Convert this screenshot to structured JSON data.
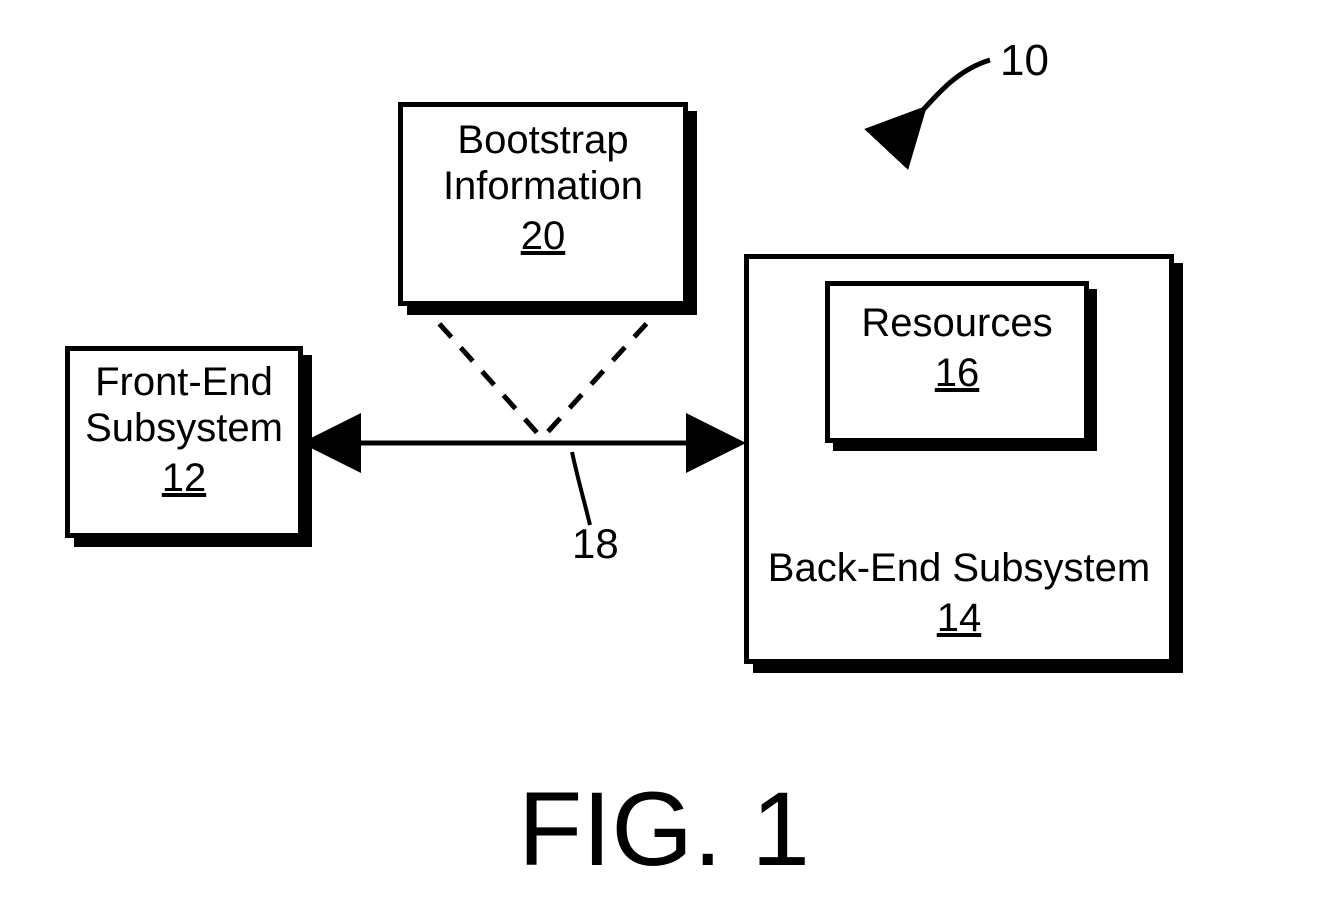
{
  "figureLabel": "FIG. 1",
  "systemRef": "10",
  "linkRef": "18",
  "boxes": {
    "frontEnd": {
      "line1": "Front-End",
      "line2": "Subsystem",
      "ref": "12"
    },
    "bootstrap": {
      "line1": "Bootstrap",
      "line2": "Information",
      "ref": "20"
    },
    "backEnd": {
      "line1": "Back-End Subsystem",
      "ref": "14"
    },
    "resources": {
      "line1": "Resources",
      "ref": "16"
    }
  }
}
